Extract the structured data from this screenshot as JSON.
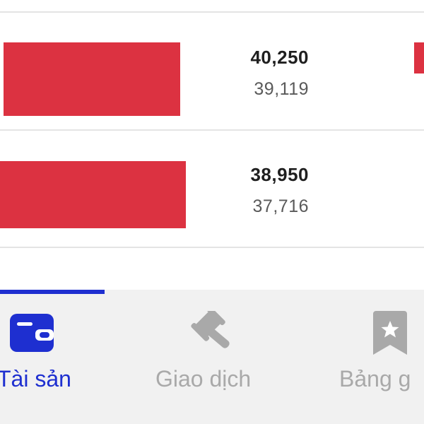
{
  "rows": [
    {
      "price": "40,250",
      "reference": "39,119"
    },
    {
      "price": "38,950",
      "reference": "37,716"
    }
  ],
  "bottom_nav": {
    "active_tab": "Tài sản",
    "tabs": [
      {
        "label": "Tài sản",
        "icon": "wallet-icon",
        "active": true
      },
      {
        "label": "Giao dịch",
        "icon": "gavel-icon",
        "active": false
      },
      {
        "label": "Bảng g",
        "icon": "bookmark-star-icon",
        "active": false
      }
    ]
  },
  "colors": {
    "bar": "#dc3241",
    "active": "#1e2fd0",
    "inactive": "#a9a9a9",
    "nav_background": "#f1f1f1"
  }
}
